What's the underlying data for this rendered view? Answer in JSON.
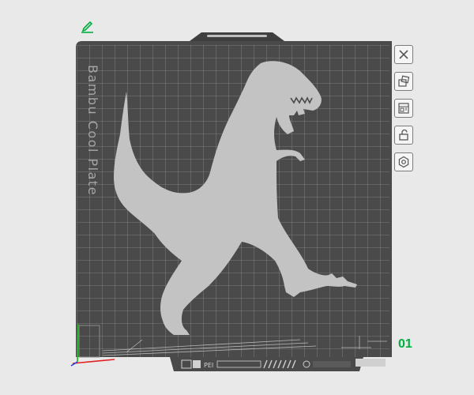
{
  "plate": {
    "name": "Bambu Cool Plate",
    "number": "01",
    "bottom_strip_label": "PEI"
  },
  "toolbar": {
    "items": [
      {
        "icon": "close-icon",
        "label": "Remove plate"
      },
      {
        "icon": "orient-icon",
        "label": "Auto orient"
      },
      {
        "icon": "arrange-icon",
        "label": "Arrange"
      },
      {
        "icon": "lock-icon",
        "label": "Lock plate"
      },
      {
        "icon": "settings-icon",
        "label": "Plate settings"
      }
    ]
  },
  "colors": {
    "background": "#e9e9e9",
    "plate": "#4a4a4a",
    "grid": "#8c8c8c",
    "model": "#c3c3c3",
    "accent_green": "#00ae42",
    "axis_x": "#e02020",
    "axis_y": "#20b020",
    "axis_z": "#2040e0"
  }
}
